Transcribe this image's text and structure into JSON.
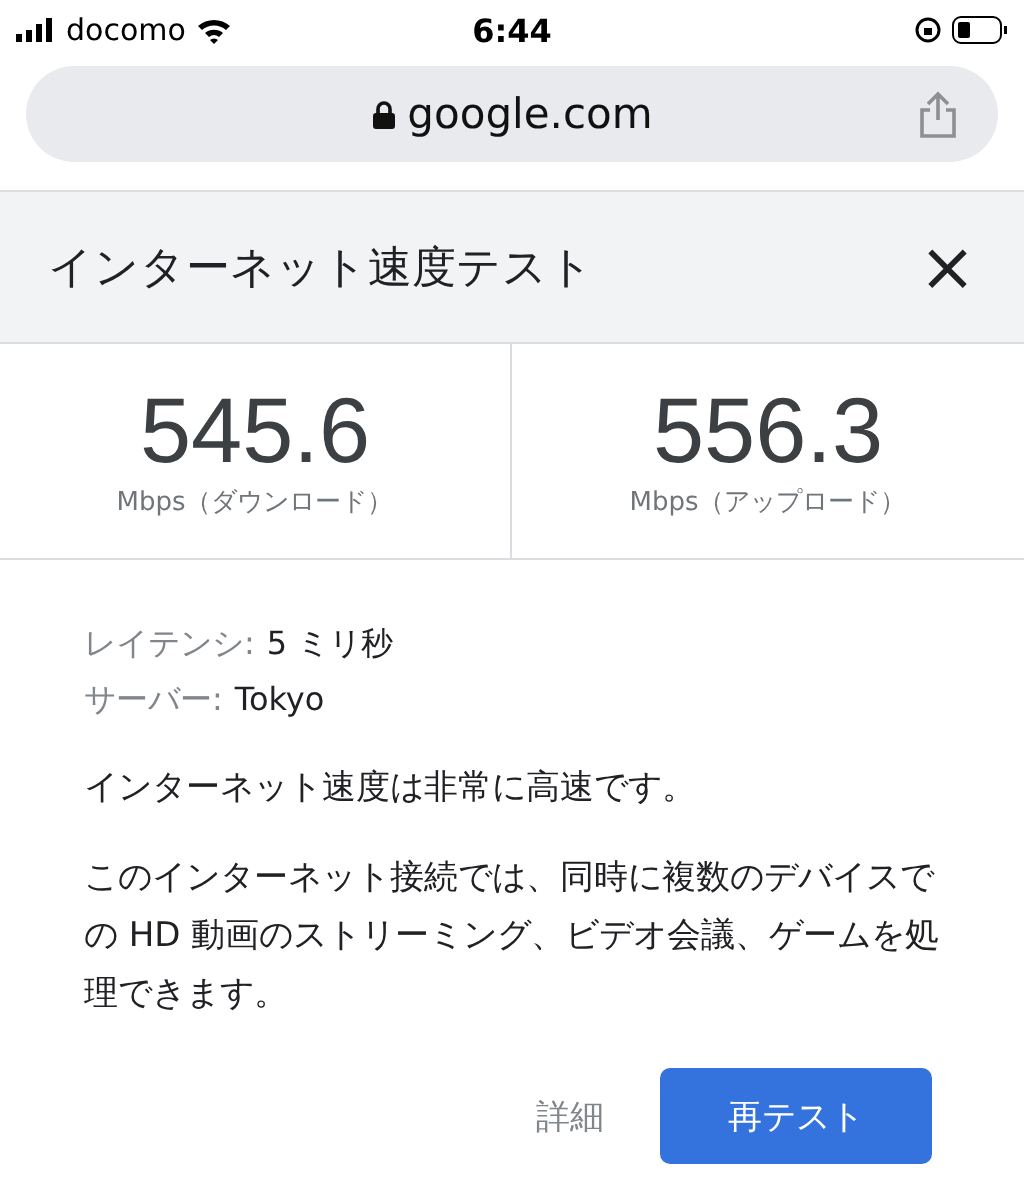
{
  "status_bar": {
    "carrier": "docomo",
    "time": "6:44"
  },
  "address_bar": {
    "url": "google.com"
  },
  "card": {
    "title": "インターネット速度テスト",
    "close": "×",
    "speeds": [
      {
        "value": "545.6",
        "unit": "Mbps（ダウンロード）"
      },
      {
        "value": "556.3",
        "unit": "Mbps（アップロード）"
      }
    ],
    "details": [
      {
        "label": "レイテンシ:",
        "value": "5 ミリ秒"
      },
      {
        "label": "サーバー:",
        "value": "Tokyo"
      }
    ],
    "summary": "インターネット速度は非常に高速です。",
    "description": "このインターネット接続では、同時に複数のデバイスでの HD 動画のストリーミング、ビデオ会議、ゲームを処理できます。",
    "buttons": [
      {
        "label": "詳細",
        "kind": "text"
      },
      {
        "label": "再テスト",
        "kind": "primary"
      }
    ]
  }
}
